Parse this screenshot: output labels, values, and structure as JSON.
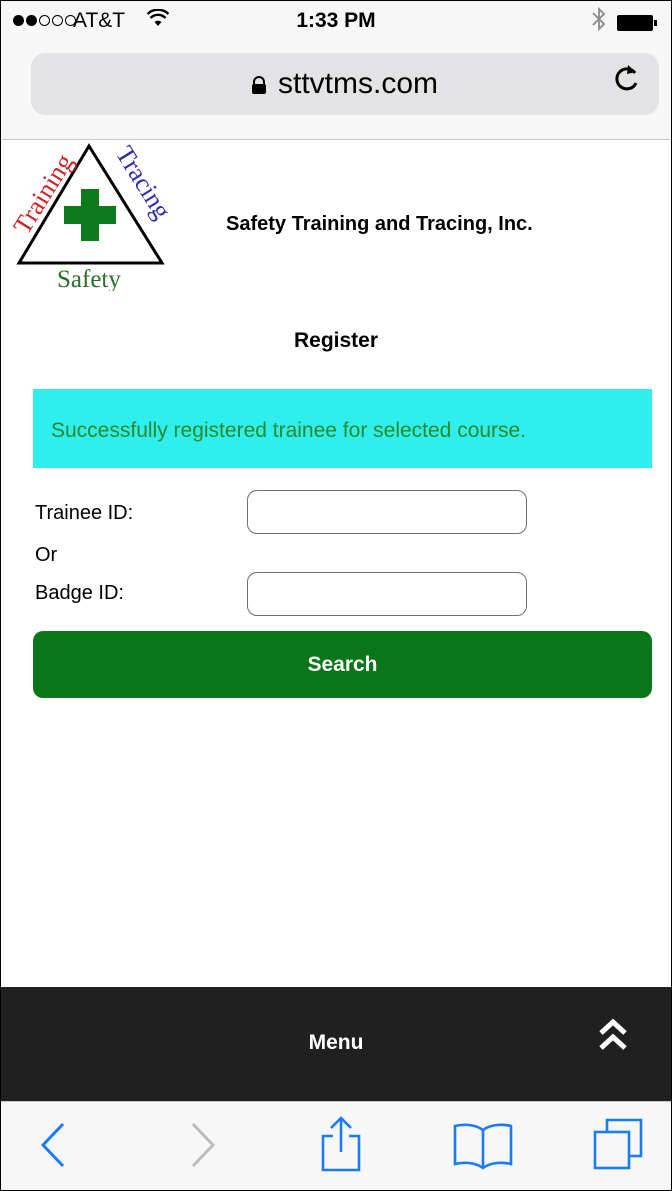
{
  "status_bar": {
    "carrier": "AT&T",
    "time": "1:33 PM"
  },
  "browser": {
    "url": "sttvtms.com"
  },
  "logo": {
    "word_left": "Training",
    "word_right": "Tracing",
    "word_bottom": "Safety"
  },
  "header": {
    "company_name": "Safety Training and Tracing, Inc."
  },
  "page": {
    "title": "Register",
    "success_message": "Successfully registered trainee for selected course."
  },
  "form": {
    "trainee_label": "Trainee ID:",
    "trainee_value": "",
    "or_label": "Or",
    "badge_label": "Badge ID:",
    "badge_value": "",
    "search_label": "Search"
  },
  "menu": {
    "label": "Menu"
  },
  "colors": {
    "banner": "#2eeeee",
    "banner_text": "#2a8a2a",
    "button": "#0b7519",
    "menu_bar": "#202020",
    "ios_blue": "#1a7cfa"
  }
}
